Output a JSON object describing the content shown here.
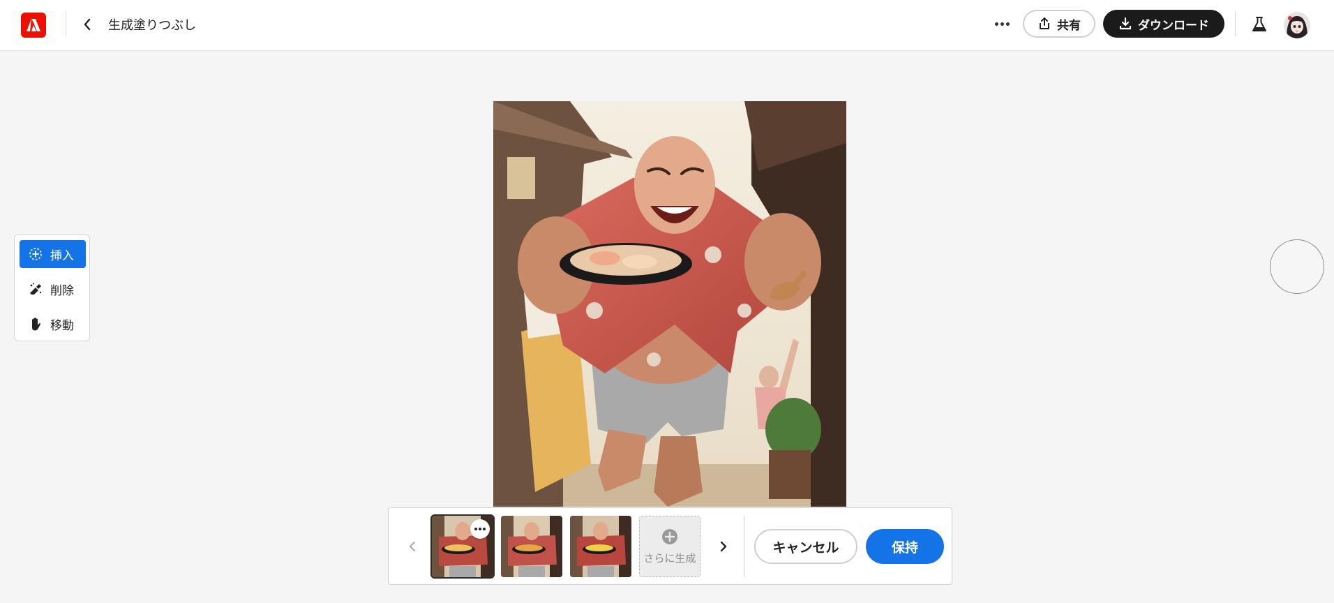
{
  "header": {
    "title": "生成塗りつぶし",
    "share_label": "共有",
    "download_label": "ダウンロード"
  },
  "tools": {
    "insert_label": "挿入",
    "remove_label": "削除",
    "move_label": "移動"
  },
  "variations": {
    "generate_more_label": "さらに生成",
    "cancel_label": "キャンセル",
    "keep_label": "保持"
  },
  "colors": {
    "accent": "#1473e6",
    "adobe_red": "#eb1000",
    "dark_button": "#1b1b1b"
  }
}
